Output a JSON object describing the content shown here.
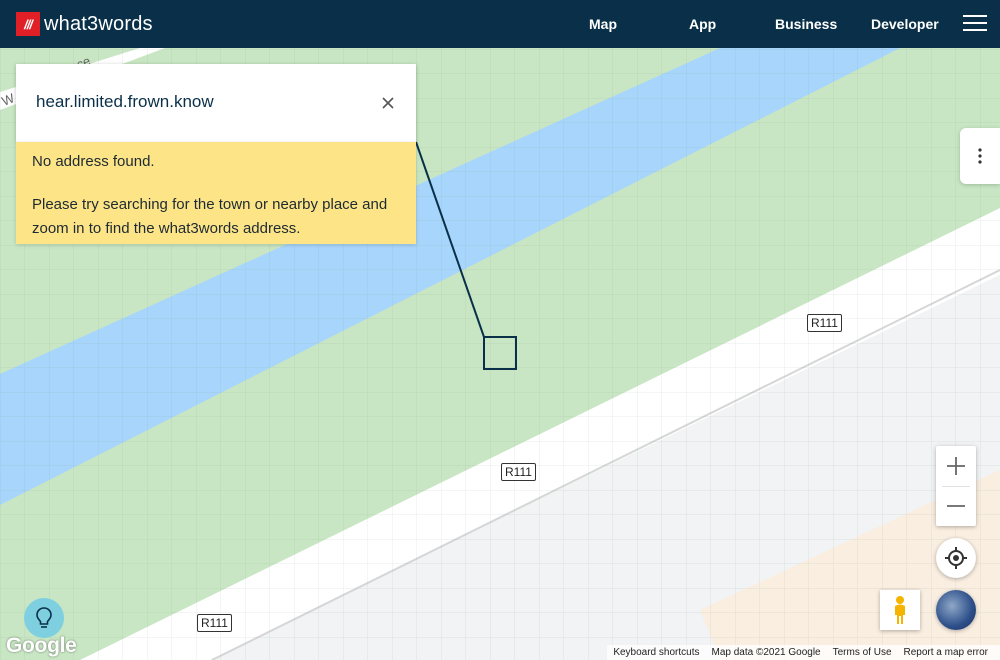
{
  "header": {
    "logo_mark": "///",
    "logo_text": "what3words",
    "nav": [
      "Map",
      "App",
      "Business",
      "Developer"
    ]
  },
  "search": {
    "value": "hear.limited.frown.know"
  },
  "notice": {
    "title": "No address found.",
    "body": "Please try searching for the town or nearby place and zoom in to find the what3words address."
  },
  "map": {
    "road_labels": [
      "R111",
      "R111",
      "R111"
    ],
    "street_fragment": "W",
    "street_fragment_2": "ace",
    "colors": {
      "land": "#c8e6c3",
      "water": "#a8d5fb",
      "road": "#ffffff",
      "urban": "#f1f3f4",
      "square": "#0a3049"
    }
  },
  "footer": {
    "google": "Google",
    "keyboard_shortcuts": "Keyboard shortcuts",
    "map_data": "Map data ©2021 Google",
    "terms": "Terms of Use",
    "report": "Report a map error"
  },
  "icons": {
    "menu": "hamburger-icon",
    "clear": "close-icon",
    "more": "kebab-icon",
    "zoom_in": "plus-icon",
    "zoom_out": "minus-icon",
    "locate": "crosshair-icon",
    "street_view": "pegman-icon",
    "layers": "globe-icon",
    "tips": "lightbulb-icon"
  }
}
